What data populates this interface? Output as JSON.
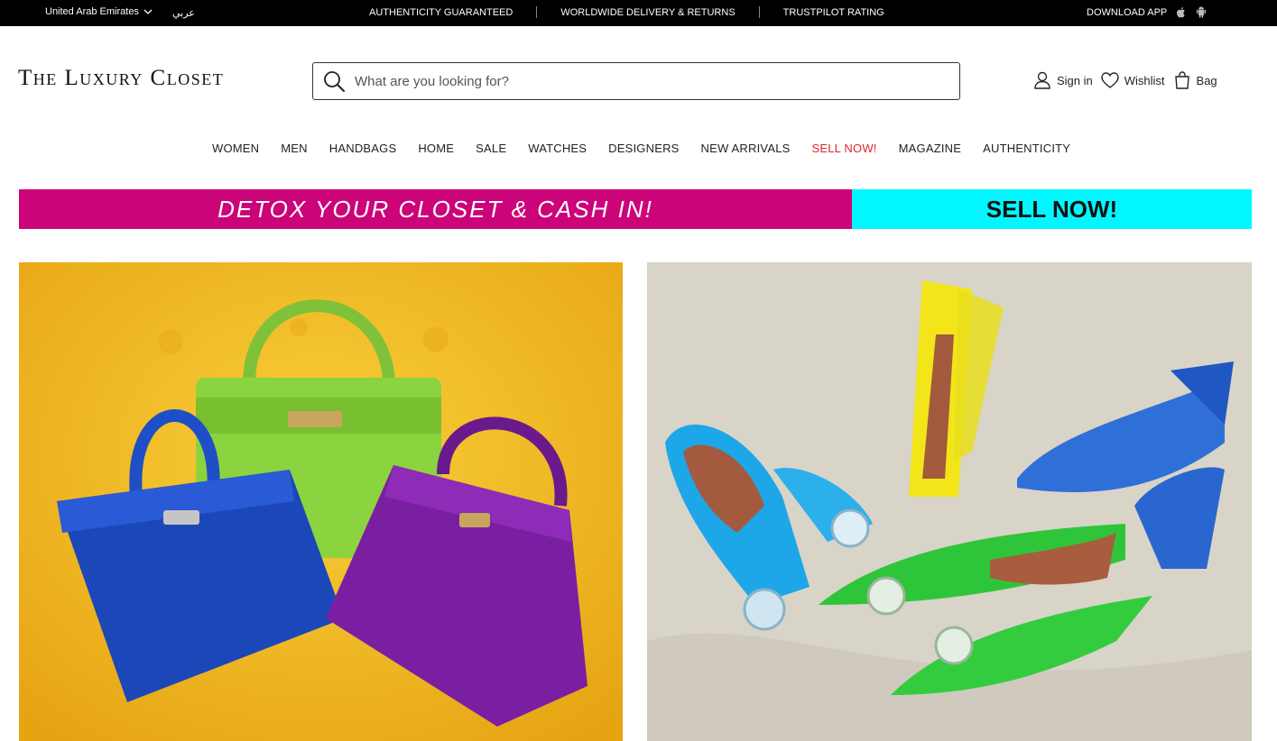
{
  "topbar": {
    "country": "United Arab Emirates",
    "language": "عربي",
    "promos": [
      "AUTHENTICITY GUARANTEED",
      "WORLDWIDE DELIVERY & RETURNS",
      "TRUSTPILOT RATING"
    ],
    "download_label": "DOWNLOAD APP",
    "download_icons": [
      "apple-icon",
      "android-icon"
    ]
  },
  "header": {
    "logo_text": "The Luxury Closet",
    "search_placeholder": "What are you looking for?",
    "search_icon": "search-icon",
    "sign_in": "Sign in",
    "wishlist": "Wishlist",
    "bag": "Bag"
  },
  "nav": {
    "items": [
      "WOMEN",
      "MEN",
      "HANDBAGS",
      "HOME",
      "SALE",
      "WATCHES",
      "DESIGNERS",
      "NEW ARRIVALS",
      "SELL NOW!",
      "MAGAZINE",
      "AUTHENTICITY"
    ],
    "highlight_color": "#e0262c"
  },
  "banner": {
    "left_text": "DETOX YOUR CLOSET & CASH IN!",
    "right_text": "SELL NOW!",
    "left_color": "#cc0479",
    "right_color": "#00f7ff"
  },
  "colors": {
    "topbar": "#000000",
    "accent_red": "#e0262c"
  }
}
